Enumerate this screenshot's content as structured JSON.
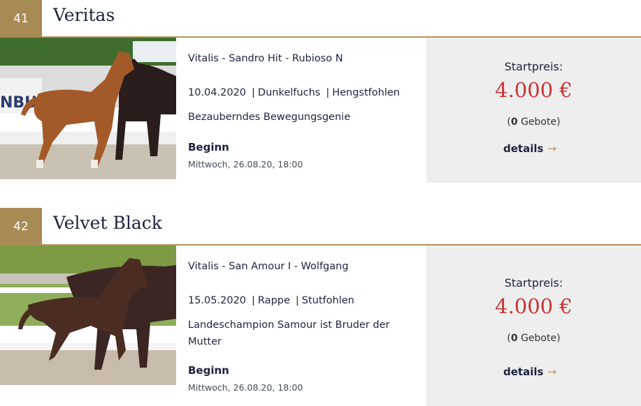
{
  "lots": [
    {
      "number": "41",
      "name": "Veritas",
      "pedigree": "Vitalis - Sandro Hit - Rubioso N",
      "birth_date": "10.04.2020",
      "color": "Dunkelfuchs",
      "category": "Hengstfohlen",
      "description": "Bezauberndes Bewegungsgenie",
      "begin_label": "Beginn",
      "begin_date": "Mittwoch, 26.08.20, 18:00",
      "price_label": "Startpreis:",
      "price": "4.000 €",
      "bid_count": "0",
      "bid_label": "Gebote",
      "details_label": "details",
      "details_icon": "arrow-right-icon"
    },
    {
      "number": "42",
      "name": "Velvet Black",
      "pedigree": "Vitalis - San Amour I - Wolfgang",
      "birth_date": "15.05.2020",
      "color": "Rappe",
      "category": "Stutfohlen",
      "description": "Landeschampion Samour ist Bruder der Mutter",
      "begin_label": "Beginn",
      "begin_date": "Mittwoch, 26.08.20, 18:00",
      "price_label": "Startpreis:",
      "price": "4.000 €",
      "bid_count": "0",
      "bid_label": "Gebote",
      "details_label": "details",
      "details_icon": "arrow-right-icon"
    }
  ],
  "colors": {
    "accent_gold": "#a88a55",
    "title_navy": "#1c2340",
    "price_red": "#cc3333",
    "panel_gray": "#eeeeee"
  }
}
